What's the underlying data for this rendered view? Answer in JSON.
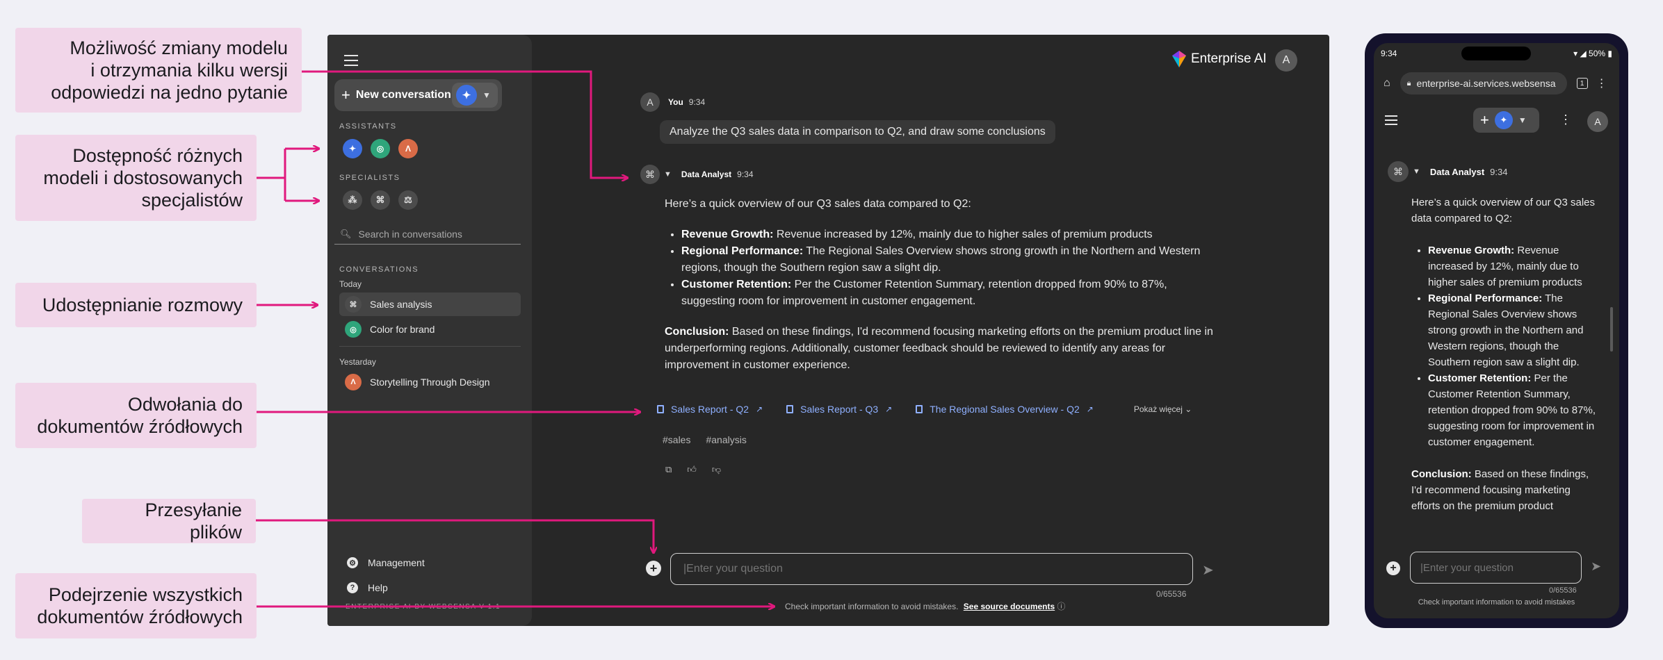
{
  "callouts": {
    "model_switch": "Możliwość zmiany modelu\ni otrzymania kilku wersji\nodpowiedzi na jedno pytanie",
    "models": "Dostępność różnych\nmodeli i dostosowanych\nspecjalistów",
    "share": "Udostępnianie rozmowy",
    "references": "Odwołania do\ndokumentów źródłowych",
    "upload": "Przesyłanie plików",
    "preview": "Podejrzenie wszystkich\ndokumentów źródłowych"
  },
  "sidebar": {
    "new_conversation": "New conversation",
    "assistants_label": "ASSISTANTS",
    "specialists_label": "SPECIALISTS",
    "search_placeholder": "Search in conversations",
    "conversations_label": "CONVERSATIONS",
    "today_label": "Today",
    "yesterday_label": "Yestarday",
    "conversations_today": [
      {
        "title": "Sales analysis",
        "icon": "data-analyst-icon"
      },
      {
        "title": "Color for brand",
        "icon": "assistant-green-icon"
      }
    ],
    "conversations_yesterday": [
      {
        "title": "Storytelling Through Design",
        "icon": "assistant-orange-icon"
      }
    ],
    "management": "Management",
    "help": "Help",
    "version": "ENTERPRISE AI BY WEBSENSA V 1.1"
  },
  "header": {
    "brand": "Enterprise AI",
    "user_initial": "A"
  },
  "chat": {
    "user_name": "You",
    "user_time": "9:34",
    "user_initial": "A",
    "question": "Analyze the Q3 sales data in comparison to Q2, and draw some conclusions",
    "bot_name": "Data Analyst",
    "bot_time": "9:34",
    "intro": "Here’s a quick overview of our Q3 sales data compared to Q2:",
    "bullets": [
      {
        "title": "Revenue Growth:",
        "text": " Revenue increased by 12%, mainly due to higher sales of premium products"
      },
      {
        "title": "Regional Performance:",
        "text": " The Regional Sales Overview shows strong growth in the Northern and Western regions, though the Southern region saw a slight dip."
      },
      {
        "title": "Customer Retention:",
        "text": " Per the Customer Retention Summary, retention dropped from 90% to 87%, suggesting room for improvement in customer engagement."
      }
    ],
    "conclusion_title": "Conclusion:",
    "conclusion_text": " Based on these findings, I'd recommend focusing marketing efforts on the premium product line in underperforming regions. Additionally, customer feedback should be reviewed to identify any areas for improvement in customer experience.",
    "sources": [
      "Sales Report - Q2",
      "Sales Report - Q3",
      "The Regional Sales Overview - Q2"
    ],
    "show_more": "Pokaż więcej",
    "tags": [
      "#sales",
      "#analysis"
    ],
    "input_placeholder": "|Enter your question",
    "counter": "0/65536",
    "disclaimer": "Check important information to avoid mistakes.",
    "see_sources": "See source documents"
  },
  "phone": {
    "time": "9:34",
    "battery": "50%",
    "url": "enterprise-ai.services.websensa",
    "tab_count": "1",
    "user_initial": "A",
    "bot_name": "Data Analyst",
    "bot_time": "9:34",
    "intro": "Here’s a quick overview of our Q3 sales data compared to Q2:",
    "bullets": [
      {
        "title": "Revenue Growth:",
        "text": " Revenue increased by 12%, mainly due to higher sales of premium products"
      },
      {
        "title": "Regional Performance:",
        "text": " The Regional Sales Overview shows strong growth in the Northern and Western regions, though the Southern region saw a slight dip."
      },
      {
        "title": "Customer Retention:",
        "text": " Per the Customer Retention Summary, retention dropped from 90% to 87%, suggesting room for improvement in customer engagement."
      }
    ],
    "conclusion_title": "Conclusion:",
    "conclusion_text": " Based on these findings, I'd recommend focusing marketing efforts on the premium product",
    "input_placeholder": "|Enter your question",
    "counter": "0/65536",
    "disclaimer": "Check important information to avoid mistakes"
  },
  "colors": {
    "accent_pink": "#e0197d",
    "callout_bg": "#f1d6e9",
    "app_bg": "#272727",
    "sidebar_bg": "#323232",
    "link_blue": "#8fb0ff"
  }
}
